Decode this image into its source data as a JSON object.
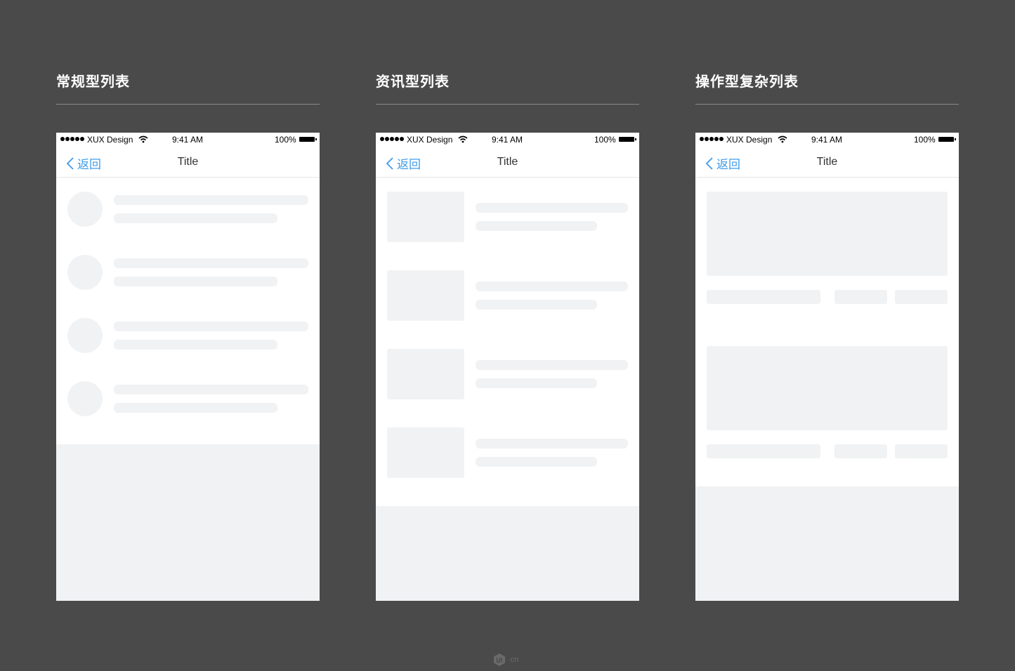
{
  "columns": [
    {
      "title": "常规型列表",
      "status": {
        "carrier": "XUX Design",
        "time": "9:41 AM",
        "battery": "100%"
      },
      "nav": {
        "back_label": "返回",
        "title": "Title"
      }
    },
    {
      "title": "资讯型列表",
      "status": {
        "carrier": "XUX Design",
        "time": "9:41 AM",
        "battery": "100%"
      },
      "nav": {
        "back_label": "返回",
        "title": "Title"
      }
    },
    {
      "title": "操作型复杂列表",
      "status": {
        "carrier": "XUX Design",
        "time": "9:41 AM",
        "battery": "100%"
      },
      "nav": {
        "back_label": "返回",
        "title": "Title"
      }
    }
  ],
  "footer": {
    "logo_text": "·cn"
  },
  "colors": {
    "background": "#4a4a4a",
    "placeholder": "#f1f2f4",
    "accent": "#3f9be8"
  },
  "icons": [
    "signal-dots-icon",
    "wifi-icon",
    "battery-icon",
    "chevron-left-icon",
    "ui-cn-logo-icon"
  ]
}
